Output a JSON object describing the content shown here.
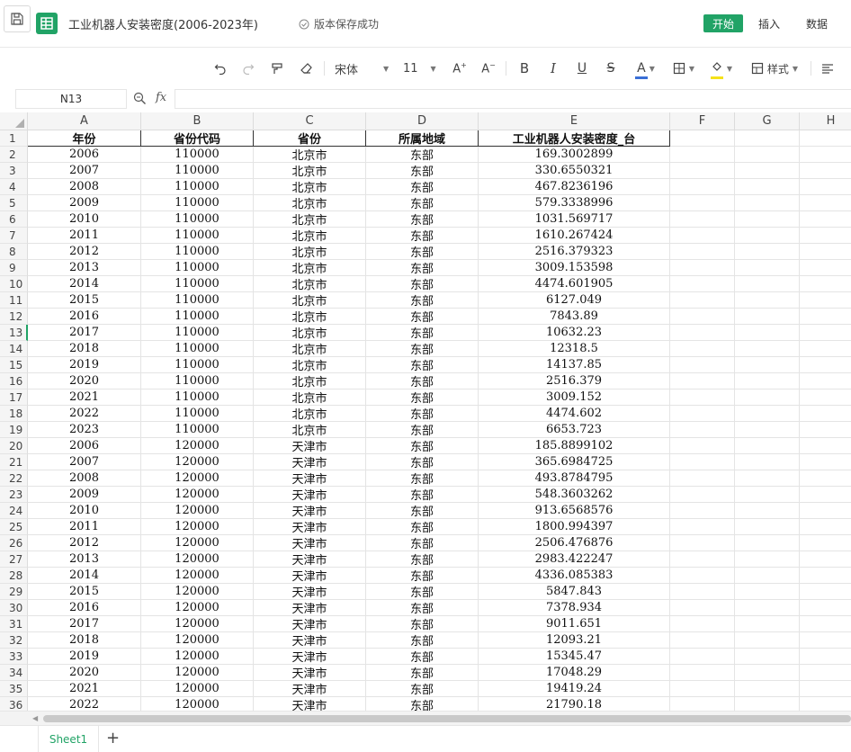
{
  "doc_title": "工业机器人安装密度(2006-2023年)",
  "save_status": "版本保存成功",
  "tabs": {
    "start": "开始",
    "insert": "插入",
    "data": "数据"
  },
  "toolbar": {
    "font_name": "宋体",
    "font_size": "11",
    "style_label": "样式",
    "font_color": "#3a6fd6",
    "fill_color": "#f5e21a"
  },
  "namebox": "N13",
  "columns": [
    "A",
    "B",
    "C",
    "D",
    "E",
    "F",
    "G",
    "H"
  ],
  "header_row": [
    "年份",
    "省份代码",
    "省份",
    "所属地域",
    "工业机器人安装密度_台"
  ],
  "rows": [
    [
      "2006",
      "110000",
      "北京市",
      "东部",
      "169.3002899"
    ],
    [
      "2007",
      "110000",
      "北京市",
      "东部",
      "330.6550321"
    ],
    [
      "2008",
      "110000",
      "北京市",
      "东部",
      "467.8236196"
    ],
    [
      "2009",
      "110000",
      "北京市",
      "东部",
      "579.3338996"
    ],
    [
      "2010",
      "110000",
      "北京市",
      "东部",
      "1031.569717"
    ],
    [
      "2011",
      "110000",
      "北京市",
      "东部",
      "1610.267424"
    ],
    [
      "2012",
      "110000",
      "北京市",
      "东部",
      "2516.379323"
    ],
    [
      "2013",
      "110000",
      "北京市",
      "东部",
      "3009.153598"
    ],
    [
      "2014",
      "110000",
      "北京市",
      "东部",
      "4474.601905"
    ],
    [
      "2015",
      "110000",
      "北京市",
      "东部",
      "6127.049"
    ],
    [
      "2016",
      "110000",
      "北京市",
      "东部",
      "7843.89"
    ],
    [
      "2017",
      "110000",
      "北京市",
      "东部",
      "10632.23"
    ],
    [
      "2018",
      "110000",
      "北京市",
      "东部",
      "12318.5"
    ],
    [
      "2019",
      "110000",
      "北京市",
      "东部",
      "14137.85"
    ],
    [
      "2020",
      "110000",
      "北京市",
      "东部",
      "2516.379"
    ],
    [
      "2021",
      "110000",
      "北京市",
      "东部",
      "3009.152"
    ],
    [
      "2022",
      "110000",
      "北京市",
      "东部",
      "4474.602"
    ],
    [
      "2023",
      "110000",
      "北京市",
      "东部",
      "6653.723"
    ],
    [
      "2006",
      "120000",
      "天津市",
      "东部",
      "185.8899102"
    ],
    [
      "2007",
      "120000",
      "天津市",
      "东部",
      "365.6984725"
    ],
    [
      "2008",
      "120000",
      "天津市",
      "东部",
      "493.8784795"
    ],
    [
      "2009",
      "120000",
      "天津市",
      "东部",
      "548.3603262"
    ],
    [
      "2010",
      "120000",
      "天津市",
      "东部",
      "913.6568576"
    ],
    [
      "2011",
      "120000",
      "天津市",
      "东部",
      "1800.994397"
    ],
    [
      "2012",
      "120000",
      "天津市",
      "东部",
      "2506.476876"
    ],
    [
      "2013",
      "120000",
      "天津市",
      "东部",
      "2983.422247"
    ],
    [
      "2014",
      "120000",
      "天津市",
      "东部",
      "4336.085383"
    ],
    [
      "2015",
      "120000",
      "天津市",
      "东部",
      "5847.843"
    ],
    [
      "2016",
      "120000",
      "天津市",
      "东部",
      "7378.934"
    ],
    [
      "2017",
      "120000",
      "天津市",
      "东部",
      "9011.651"
    ],
    [
      "2018",
      "120000",
      "天津市",
      "东部",
      "12093.21"
    ],
    [
      "2019",
      "120000",
      "天津市",
      "东部",
      "15345.47"
    ],
    [
      "2020",
      "120000",
      "天津市",
      "东部",
      "17048.29"
    ],
    [
      "2021",
      "120000",
      "天津市",
      "东部",
      "19419.24"
    ],
    [
      "2022",
      "120000",
      "天津市",
      "东部",
      "21790.18"
    ]
  ],
  "sheet_tab": "Sheet1"
}
